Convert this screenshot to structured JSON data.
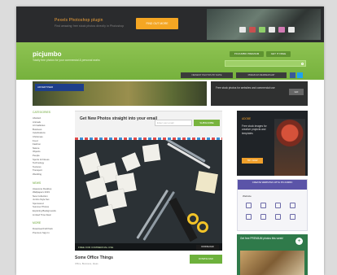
{
  "banner": {
    "headline": "Pexels Photoshop plugin",
    "subline": "Find amazing free stock photos directly in Photoshop",
    "button_label": "FIND OUT MORE"
  },
  "header": {
    "logo": "picjumbo",
    "tagline": "Totally free photos for your commercial & personal works",
    "top_links": [
      "PICJUMBO PREMIUM",
      "GET IT FREE"
    ],
    "search_placeholder": "Search free photos…",
    "nav_links": [
      "NEWEST PHOTOS BY DATE",
      "PREMIUM MEMBERSHIP"
    ]
  },
  "ads": {
    "left_brand": "ADVERTISER",
    "right_text": "Free stock photos for websites and commercial use",
    "right_button": "GO"
  },
  "sidebar": {
    "categories_title": "CATEGORIES",
    "categories": [
      "Abstract",
      "Animals",
      "Art Galleries",
      "Business",
      "Celebrations",
      "Christmas",
      "Food",
      "Fashion",
      "Nature",
      "Objects",
      "People",
      "Sports & Fitness",
      "Technology",
      "Textures",
      "Transport",
      "Wedding"
    ],
    "news_title": "NEWS",
    "news": [
      "Awesome Desktop",
      "Wallpapers 2019",
      "New Collection",
      "Jumbo Style Set",
      "Sponsored",
      "Summer Photos",
      "Exploring Backgrounds",
      "Limited Time Deal"
    ],
    "more_title": "MORE",
    "more": [
      "Download Full Pack",
      "Premium Sign In"
    ]
  },
  "newsletter": {
    "title": "Get New Photos straight into your email",
    "input_placeholder": "Enter your email",
    "button_label": "SUBSCRIBE"
  },
  "photo": {
    "caption": "FREE FOR COMMERCIAL USE",
    "button_label": "DOWNLOAD",
    "title": "Some Office Things",
    "subtitle": "Office, Business, Ideas",
    "download_label": "DOWNLOAD"
  },
  "right": {
    "ad1_label": "ADOBE",
    "ad1_text": "Free stock images for creative projects and templates",
    "ad1_button": "TRY NOW",
    "ad2_header": "CREATE WEBSITES WITH PICJUMBO",
    "ad2_section": "Website",
    "ad3_text": "Get free PREMIUM photos this week!"
  },
  "colors": {
    "brand_green": "#78b43e",
    "banner_orange": "#f5a623",
    "dark": "#2a2b2d"
  }
}
